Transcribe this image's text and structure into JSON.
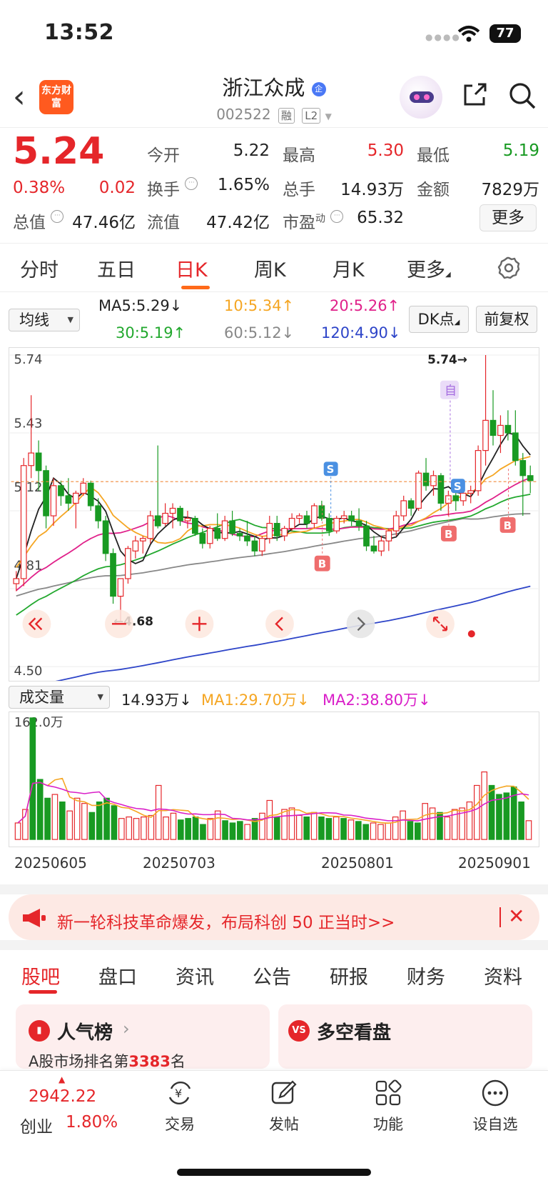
{
  "status_bar": {
    "time": "13:52",
    "battery": "77"
  },
  "header": {
    "stock_name": "浙江众成",
    "stock_code": "002522",
    "badge": "企",
    "tags": [
      "融",
      "L2"
    ],
    "logo_text": "东方财富"
  },
  "quote": {
    "price": "5.24",
    "change_pct": "0.38%",
    "change_abs": "0.02",
    "open_label": "今开",
    "open": "5.22",
    "high_label": "最高",
    "high": "5.30",
    "low_label": "最低",
    "low": "5.19",
    "turnover_label": "换手",
    "turnover": "1.65%",
    "volume_label": "总手",
    "volume": "14.93万",
    "amount_label": "金额",
    "amount": "7829万",
    "mktcap_label": "总值",
    "mktcap": "47.46亿",
    "float_label": "流值",
    "float_cap": "47.42亿",
    "pe_label": "市盈",
    "pe_sup": "动",
    "pe": "65.32",
    "more": "更多"
  },
  "chart_tabs": [
    "分时",
    "五日",
    "日K",
    "周K",
    "月K",
    "更多"
  ],
  "active_tab": "日K",
  "ma_bar": {
    "select": "均线",
    "ma5": "MA5:5.29↓",
    "ma10": "10:5.34↑",
    "ma20": "20:5.26↑",
    "ma30": "30:5.19↑",
    "ma60": "60:5.12↓",
    "ma120": "120:4.90↓",
    "dk": "DK点",
    "adjust": "前复权"
  },
  "colors": {
    "up": "#e5262a",
    "down": "#189a22",
    "ma5": "#222222",
    "ma10": "#f5a623",
    "ma20": "#e0218a",
    "ma30": "#22a82e",
    "ma60": "#888888",
    "ma120": "#2d44c8"
  },
  "kchart": {
    "y_labels": [
      "5.74",
      "5.43",
      "5.12",
      "4.81",
      "4.50"
    ],
    "high_mark": "5.74→",
    "low_mark": "←4.68",
    "marks": [
      "自",
      "S",
      "S",
      "B",
      "B",
      "B"
    ],
    "controls": [
      "double-left-icon",
      "zoom-out-icon",
      "zoom-in-icon",
      "prev-icon",
      "next-icon",
      "fullscreen-icon"
    ]
  },
  "volume": {
    "select": "成交量",
    "value": "14.93万↓",
    "ma1": "MA1:29.70万↓",
    "ma2": "MA2:38.80万↓",
    "max_label": "162.0万"
  },
  "dates": [
    "20250605",
    "20250703",
    "20250801",
    "20250901"
  ],
  "banner": {
    "text": "新一轮科技革命爆发，布局科创 50 正当时>>",
    "close": "✕"
  },
  "bottom_tabs": [
    "股吧",
    "盘口",
    "资讯",
    "公告",
    "研报",
    "财务",
    "资料"
  ],
  "cards": {
    "popularity": "人气榜",
    "popularity_rank_prefix": "A股市场排名第",
    "popularity_rank": "3383",
    "popularity_rank_suffix": "名",
    "bullbear": "多空看盘"
  },
  "bottom_nav": {
    "index_value": "2942.22",
    "index_name": "创业",
    "index_change": "1.80%",
    "items": [
      "交易",
      "发帖",
      "功能",
      "设自选"
    ]
  },
  "chart_data": {
    "type": "candlestick",
    "ylim": [
      4.5,
      5.74
    ],
    "candles": [
      {
        "o": 4.83,
        "h": 4.88,
        "l": 4.8,
        "c": 4.85
      },
      {
        "o": 4.85,
        "h": 5.33,
        "l": 4.82,
        "c": 5.3
      },
      {
        "o": 5.3,
        "h": 5.58,
        "l": 5.25,
        "c": 5.35
      },
      {
        "o": 5.35,
        "h": 5.4,
        "l": 5.2,
        "c": 5.28
      },
      {
        "o": 5.28,
        "h": 5.3,
        "l": 5.05,
        "c": 5.1
      },
      {
        "o": 5.1,
        "h": 5.25,
        "l": 5.06,
        "c": 5.22
      },
      {
        "o": 5.22,
        "h": 5.24,
        "l": 5.14,
        "c": 5.18
      },
      {
        "o": 5.18,
        "h": 5.25,
        "l": 5.12,
        "c": 5.15
      },
      {
        "o": 5.15,
        "h": 5.2,
        "l": 5.05,
        "c": 5.19
      },
      {
        "o": 5.19,
        "h": 5.25,
        "l": 5.18,
        "c": 5.23
      },
      {
        "o": 5.23,
        "h": 5.24,
        "l": 5.12,
        "c": 5.14
      },
      {
        "o": 5.14,
        "h": 5.17,
        "l": 5.05,
        "c": 5.08
      },
      {
        "o": 5.08,
        "h": 5.1,
        "l": 4.92,
        "c": 4.95
      },
      {
        "o": 4.95,
        "h": 4.97,
        "l": 4.75,
        "c": 4.78
      },
      {
        "o": 4.78,
        "h": 4.85,
        "l": 4.68,
        "c": 4.85
      },
      {
        "o": 4.85,
        "h": 4.98,
        "l": 4.83,
        "c": 4.97
      },
      {
        "o": 4.96,
        "h": 5.02,
        "l": 4.93,
        "c": 5.0
      },
      {
        "o": 5.0,
        "h": 5.02,
        "l": 4.95,
        "c": 5.01
      },
      {
        "o": 5.01,
        "h": 5.12,
        "l": 4.99,
        "c": 5.1
      },
      {
        "o": 5.1,
        "h": 5.38,
        "l": 5.05,
        "c": 5.06
      },
      {
        "o": 5.07,
        "h": 5.15,
        "l": 5.06,
        "c": 5.11
      },
      {
        "o": 5.11,
        "h": 5.15,
        "l": 5.05,
        "c": 5.13
      },
      {
        "o": 5.13,
        "h": 5.14,
        "l": 5.06,
        "c": 5.08
      },
      {
        "o": 5.08,
        "h": 5.12,
        "l": 5.05,
        "c": 5.09
      },
      {
        "o": 5.09,
        "h": 5.1,
        "l": 5.02,
        "c": 5.03
      },
      {
        "o": 5.03,
        "h": 5.05,
        "l": 4.97,
        "c": 4.99
      },
      {
        "o": 4.99,
        "h": 5.06,
        "l": 4.97,
        "c": 5.05
      },
      {
        "o": 5.05,
        "h": 5.11,
        "l": 5.0,
        "c": 5.01
      },
      {
        "o": 5.01,
        "h": 5.1,
        "l": 5.0,
        "c": 5.08
      },
      {
        "o": 5.08,
        "h": 5.12,
        "l": 5.02,
        "c": 5.03
      },
      {
        "o": 5.03,
        "h": 5.05,
        "l": 5.0,
        "c": 5.02
      },
      {
        "o": 5.02,
        "h": 5.08,
        "l": 4.98,
        "c": 5.0
      },
      {
        "o": 5.0,
        "h": 5.02,
        "l": 4.94,
        "c": 4.96
      },
      {
        "o": 4.96,
        "h": 5.02,
        "l": 4.94,
        "c": 5.01
      },
      {
        "o": 5.01,
        "h": 5.1,
        "l": 4.99,
        "c": 5.07
      },
      {
        "o": 5.07,
        "h": 5.1,
        "l": 5.0,
        "c": 5.02
      },
      {
        "o": 5.02,
        "h": 5.06,
        "l": 5.0,
        "c": 5.05
      },
      {
        "o": 5.05,
        "h": 5.11,
        "l": 5.04,
        "c": 5.09
      },
      {
        "o": 5.09,
        "h": 5.11,
        "l": 5.07,
        "c": 5.1
      },
      {
        "o": 5.1,
        "h": 5.12,
        "l": 5.05,
        "c": 5.07
      },
      {
        "o": 5.07,
        "h": 5.15,
        "l": 5.05,
        "c": 5.14
      },
      {
        "o": 5.14,
        "h": 5.16,
        "l": 5.08,
        "c": 5.09
      },
      {
        "o": 5.09,
        "h": 5.11,
        "l": 5.02,
        "c": 5.04
      },
      {
        "o": 5.04,
        "h": 5.1,
        "l": 5.03,
        "c": 5.09
      },
      {
        "o": 5.09,
        "h": 5.12,
        "l": 5.07,
        "c": 5.1
      },
      {
        "o": 5.1,
        "h": 5.12,
        "l": 5.06,
        "c": 5.08
      },
      {
        "o": 5.08,
        "h": 5.13,
        "l": 5.04,
        "c": 5.06
      },
      {
        "o": 5.06,
        "h": 5.08,
        "l": 4.96,
        "c": 4.98
      },
      {
        "o": 4.98,
        "h": 5.02,
        "l": 4.95,
        "c": 4.96
      },
      {
        "o": 4.96,
        "h": 5.02,
        "l": 4.94,
        "c": 5.0
      },
      {
        "o": 5.0,
        "h": 5.05,
        "l": 4.96,
        "c": 5.04
      },
      {
        "o": 5.04,
        "h": 5.12,
        "l": 5.02,
        "c": 5.1
      },
      {
        "o": 5.1,
        "h": 5.18,
        "l": 5.08,
        "c": 5.16
      },
      {
        "o": 5.16,
        "h": 5.17,
        "l": 5.1,
        "c": 5.13
      },
      {
        "o": 5.13,
        "h": 5.28,
        "l": 5.12,
        "c": 5.27
      },
      {
        "o": 5.27,
        "h": 5.33,
        "l": 5.2,
        "c": 5.22
      },
      {
        "o": 5.22,
        "h": 5.28,
        "l": 5.18,
        "c": 5.26
      },
      {
        "o": 5.26,
        "h": 5.27,
        "l": 5.12,
        "c": 5.15
      },
      {
        "o": 5.15,
        "h": 5.2,
        "l": 5.1,
        "c": 5.18
      },
      {
        "o": 5.18,
        "h": 5.21,
        "l": 5.12,
        "c": 5.16
      },
      {
        "o": 5.16,
        "h": 5.2,
        "l": 5.14,
        "c": 5.19
      },
      {
        "o": 5.19,
        "h": 5.22,
        "l": 5.15,
        "c": 5.2
      },
      {
        "o": 5.2,
        "h": 5.38,
        "l": 5.18,
        "c": 5.36
      },
      {
        "o": 5.36,
        "h": 5.74,
        "l": 5.3,
        "c": 5.48
      },
      {
        "o": 5.48,
        "h": 5.6,
        "l": 5.38,
        "c": 5.42
      },
      {
        "o": 5.42,
        "h": 5.5,
        "l": 5.35,
        "c": 5.46
      },
      {
        "o": 5.46,
        "h": 5.52,
        "l": 5.4,
        "c": 5.43
      },
      {
        "o": 5.43,
        "h": 5.52,
        "l": 5.3,
        "c": 5.32
      },
      {
        "o": 5.32,
        "h": 5.35,
        "l": 5.1,
        "c": 5.26
      },
      {
        "o": 5.26,
        "h": 5.3,
        "l": 5.19,
        "c": 5.24
      }
    ],
    "volumes": [
      {
        "v": 22,
        "up": true
      },
      {
        "v": 40,
        "up": true
      },
      {
        "v": 162,
        "up": false
      },
      {
        "v": 80,
        "up": false
      },
      {
        "v": 55,
        "up": false
      },
      {
        "v": 60,
        "up": true
      },
      {
        "v": 50,
        "up": false
      },
      {
        "v": 38,
        "up": true
      },
      {
        "v": 55,
        "up": true
      },
      {
        "v": 48,
        "up": true
      },
      {
        "v": 36,
        "up": false
      },
      {
        "v": 50,
        "up": false
      },
      {
        "v": 55,
        "up": false
      },
      {
        "v": 45,
        "up": false
      },
      {
        "v": 28,
        "up": true
      },
      {
        "v": 30,
        "up": true
      },
      {
        "v": 28,
        "up": true
      },
      {
        "v": 30,
        "up": true
      },
      {
        "v": 32,
        "up": true
      },
      {
        "v": 72,
        "up": true
      },
      {
        "v": 30,
        "up": true
      },
      {
        "v": 35,
        "up": true
      },
      {
        "v": 26,
        "up": false
      },
      {
        "v": 28,
        "up": false
      },
      {
        "v": 30,
        "up": false
      },
      {
        "v": 20,
        "up": false
      },
      {
        "v": 28,
        "up": true
      },
      {
        "v": 38,
        "up": true
      },
      {
        "v": 25,
        "up": false
      },
      {
        "v": 22,
        "up": false
      },
      {
        "v": 24,
        "up": false
      },
      {
        "v": 20,
        "up": true
      },
      {
        "v": 28,
        "up": false
      },
      {
        "v": 35,
        "up": true
      },
      {
        "v": 52,
        "up": true
      },
      {
        "v": 30,
        "up": false
      },
      {
        "v": 40,
        "up": true
      },
      {
        "v": 42,
        "up": true
      },
      {
        "v": 32,
        "up": true
      },
      {
        "v": 30,
        "up": false
      },
      {
        "v": 36,
        "up": true
      },
      {
        "v": 30,
        "up": false
      },
      {
        "v": 28,
        "up": false
      },
      {
        "v": 30,
        "up": true
      },
      {
        "v": 28,
        "up": false
      },
      {
        "v": 26,
        "up": true
      },
      {
        "v": 24,
        "up": false
      },
      {
        "v": 20,
        "up": false
      },
      {
        "v": 22,
        "up": true
      },
      {
        "v": 20,
        "up": true
      },
      {
        "v": 22,
        "up": true
      },
      {
        "v": 30,
        "up": true
      },
      {
        "v": 38,
        "up": true
      },
      {
        "v": 24,
        "up": false
      },
      {
        "v": 22,
        "up": false
      },
      {
        "v": 48,
        "up": true
      },
      {
        "v": 42,
        "up": true
      },
      {
        "v": 36,
        "up": false
      },
      {
        "v": 30,
        "up": true
      },
      {
        "v": 40,
        "up": true
      },
      {
        "v": 42,
        "up": true
      },
      {
        "v": 50,
        "up": true
      },
      {
        "v": 72,
        "up": true
      },
      {
        "v": 90,
        "up": true
      },
      {
        "v": 72,
        "up": false
      },
      {
        "v": 60,
        "up": false
      },
      {
        "v": 62,
        "up": false
      },
      {
        "v": 70,
        "up": false
      },
      {
        "v": 50,
        "up": false
      },
      {
        "v": 25,
        "up": true
      }
    ],
    "volume_ylim": [
      0,
      162
    ]
  }
}
